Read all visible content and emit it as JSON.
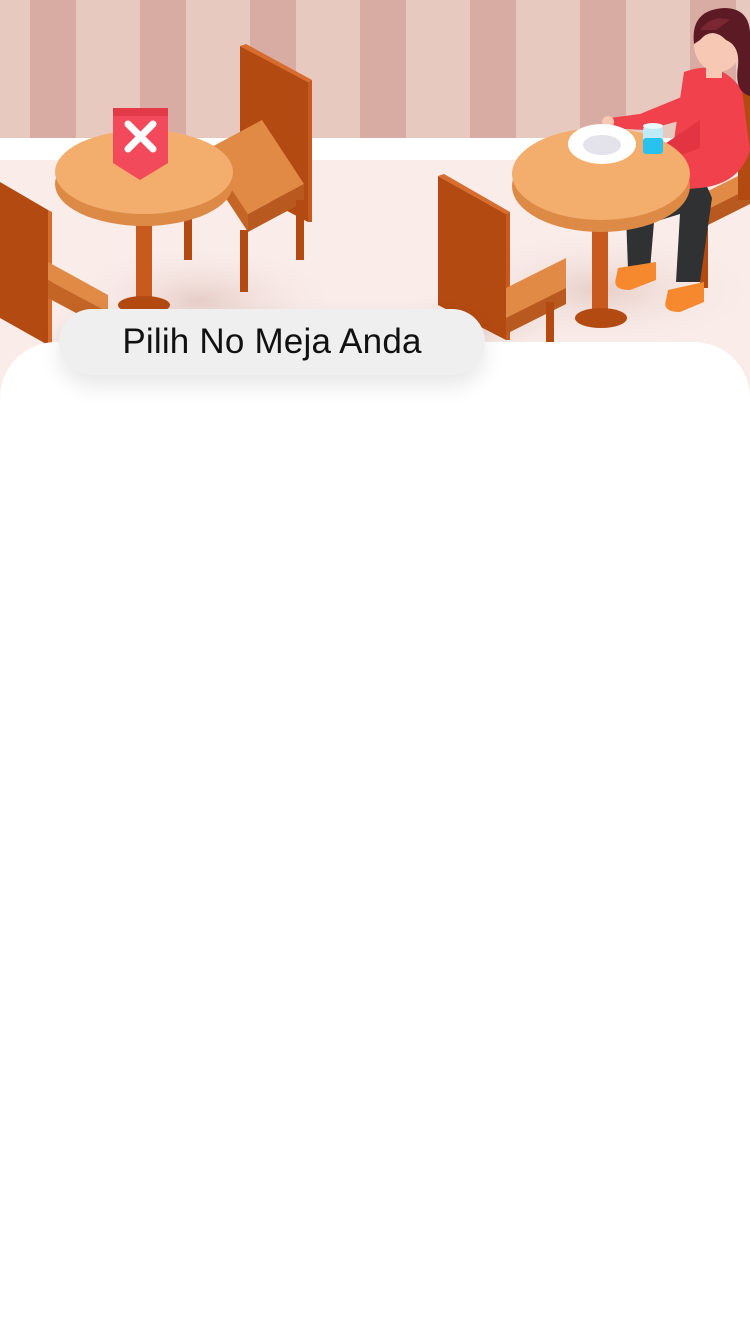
{
  "header": {
    "title": "Pilih No Meja Anda"
  },
  "illustration": {
    "subject": "restaurant-tables-illustration",
    "icons": [
      "reserved-x-icon",
      "person-icon",
      "plate-icon",
      "glass-icon"
    ]
  },
  "colors": {
    "wall_stripe_light": "#e8c9bf",
    "wall_stripe_dark": "#d8aca2",
    "floor": "#f9ece9",
    "table_top": "#f3ad6c",
    "table_edge": "#dd8a46",
    "chair": "#b34a12",
    "chair_seat": "#e08a45",
    "flag": "#f24a5a",
    "shirt": "#f0414d",
    "pants": "#2f3133",
    "shoes": "#f6892d",
    "hair": "#5b1a24",
    "pill_bg": "#efefef",
    "title_text": "#111111"
  }
}
